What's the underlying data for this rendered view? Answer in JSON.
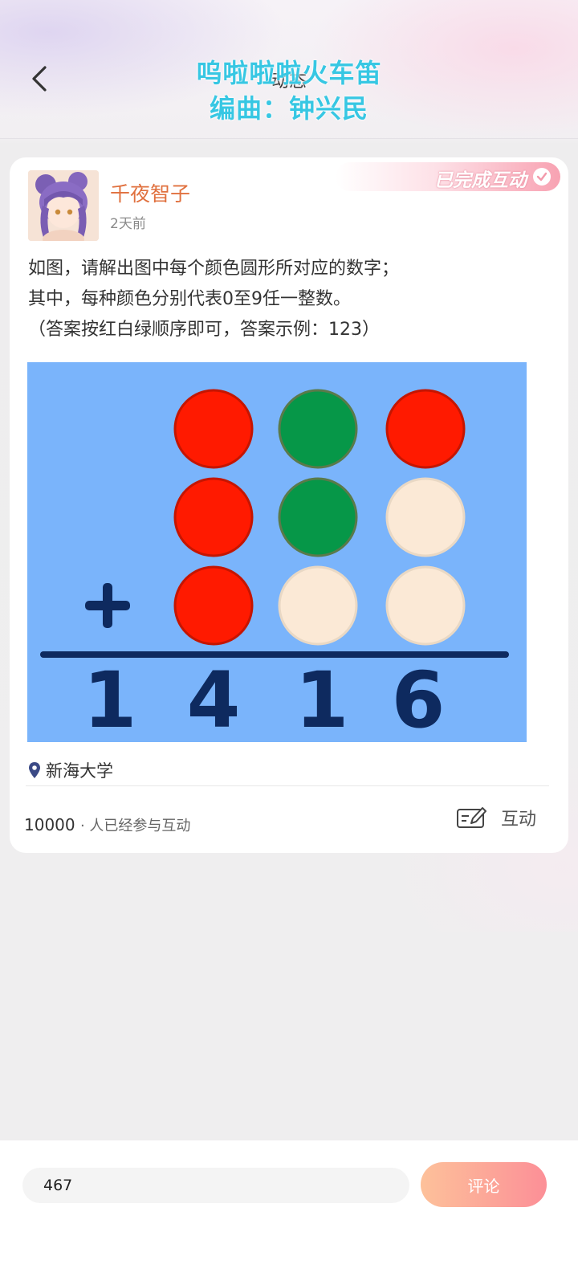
{
  "header": {
    "title": "动态",
    "back_icon": "chevron-left-icon"
  },
  "overlay": {
    "line1": "呜啦啦啦火车笛",
    "line2": "编曲：钟兴民",
    "color": "#37c7e3"
  },
  "post": {
    "badge": "已完成互动",
    "badge_icon": "check-circle-icon",
    "username": "千夜智子",
    "time_ago": "2天前",
    "text_lines": [
      "如图，请解出图中每个颜色圆形所对应的数字；",
      "其中，每种颜色分别代表0至9任一整数。",
      "（答案按红白绿顺序即可，答案示例：123）"
    ],
    "puzzle": {
      "background": "#7ab4fb",
      "rows": [
        [
          "blank",
          "red",
          "green",
          "red"
        ],
        [
          "blank",
          "red",
          "green",
          "white"
        ],
        [
          "plus",
          "red",
          "white",
          "white"
        ]
      ],
      "operator": "+",
      "sum_digits": [
        "1",
        "4",
        "1",
        "6"
      ],
      "colors": {
        "red": "#ff1a00",
        "green": "#069748",
        "white": "#fbe9d6",
        "ink": "#0e2a5f"
      }
    },
    "location_icon": "map-pin-icon",
    "location": "新海大学",
    "participants_count": "10000",
    "participants_label": "· 人已经参与互动",
    "interact_icon": "edit-note-icon",
    "interact_label": "互动"
  },
  "comment_bar": {
    "input_value": "467",
    "submit_label": "评论"
  }
}
